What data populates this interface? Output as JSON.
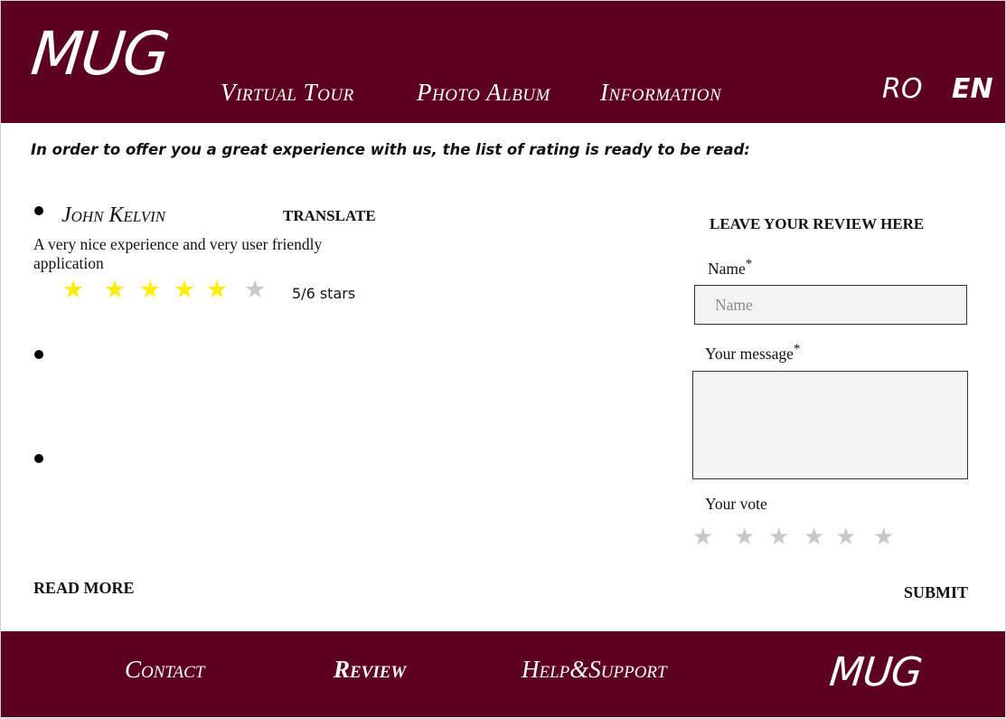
{
  "header": {
    "logo": "MUG",
    "nav": [
      "Virtual Tour",
      "Photo Album",
      "Information"
    ],
    "languages": [
      "RO",
      "EN"
    ],
    "active_language": "EN"
  },
  "main": {
    "intro": "In order to offer you a great experience with us, the list of rating is ready to be read:",
    "reviews": [
      {
        "name": "John Kelvin",
        "translate_label": "TRANSLATE",
        "text": "A very nice experience and very user friendly application",
        "rating": 5,
        "max_rating": 6,
        "rating_label": "5/6 stars"
      }
    ],
    "read_more": "READ MORE"
  },
  "form": {
    "title": "LEAVE YOUR REVIEW HERE",
    "name_label": "Name",
    "name_placeholder": "Name",
    "required_mark": "*",
    "message_label": "Your message",
    "vote_label": "Your vote",
    "vote_max": 6,
    "submit": "SUBMIT"
  },
  "footer": {
    "items": [
      "Contact",
      "Review",
      "Help&Support"
    ],
    "active": "Review",
    "logo": "MUG"
  },
  "colors": {
    "brand": "#5d0020",
    "star_on": "#ffee00",
    "star_off": "#c8c8c8"
  }
}
